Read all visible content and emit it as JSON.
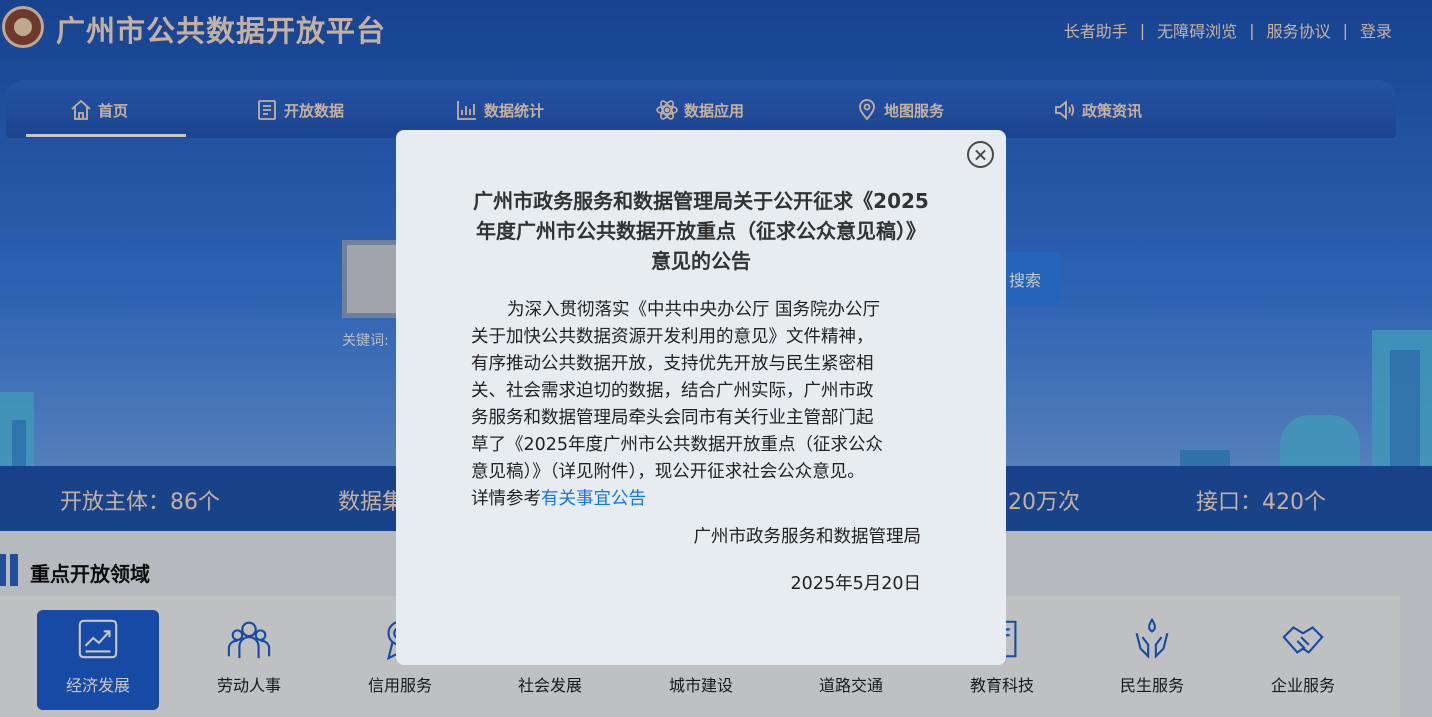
{
  "header": {
    "site_title": "广州市公共数据开放平台",
    "top_links": [
      "长者助手",
      "无障碍浏览",
      "服务协议",
      "登录"
    ],
    "separator": "|"
  },
  "nav": {
    "items": [
      {
        "label": "首页",
        "icon": "home-icon"
      },
      {
        "label": "开放数据",
        "icon": "document-icon"
      },
      {
        "label": "数据统计",
        "icon": "bar-chart-icon"
      },
      {
        "label": "数据应用",
        "icon": "atom-icon"
      },
      {
        "label": "地图服务",
        "icon": "map-pin-icon"
      },
      {
        "label": "政策资讯",
        "icon": "speaker-icon"
      }
    ],
    "active_index": 0
  },
  "search": {
    "button_label": "搜索",
    "keyword_label": "关键词:"
  },
  "stats": {
    "items": [
      "开放主体：86个",
      "数据集",
      "20万次",
      "接口：420个"
    ]
  },
  "section": {
    "title": "重点开放领域"
  },
  "domains": {
    "items": [
      {
        "label": "经济发展",
        "icon": "trend-chart-icon",
        "active": true
      },
      {
        "label": "劳动人事",
        "icon": "people-icon"
      },
      {
        "label": "信用服务",
        "icon": "medal-icon"
      },
      {
        "label": "社会发展",
        "icon": "community-icon"
      },
      {
        "label": "城市建设",
        "icon": "building-icon"
      },
      {
        "label": "道路交通",
        "icon": "road-icon"
      },
      {
        "label": "教育科技",
        "icon": "book-icon"
      },
      {
        "label": "民生服务",
        "icon": "hands-icon"
      },
      {
        "label": "企业服务",
        "icon": "handshake-icon"
      }
    ]
  },
  "modal": {
    "title_lines": [
      "广州市政务服务和数据管理局关于公开征求《2025",
      "年度广州市公共数据开放重点（征求公众意见稿）》",
      "意见的公告"
    ],
    "body_lines": [
      "为深入贯彻落实《中共中央办公厅 国务院办公厅",
      "关于加快公共数据资源开发利用的意见》文件精神，",
      "有序推动公共数据开放，支持优先开放与民生紧密相",
      "关、社会需求迫切的数据，结合广州实际，广州市政",
      "务服务和数据管理局牵头会同市有关行业主管部门起",
      "草了《2025年度广州市公共数据开放重点（征求公众",
      "意见稿）》（详见附件），现公开征求社会公众意见。"
    ],
    "detail_prefix": "详情参考",
    "detail_link": "有关事宜公告",
    "org": "广州市政务服务和数据管理局",
    "date": "2025年5月20日"
  },
  "colors": {
    "brand_blue": "#1d5fd3",
    "link_blue": "#1677e5",
    "header_text": "#fbe2cf"
  }
}
